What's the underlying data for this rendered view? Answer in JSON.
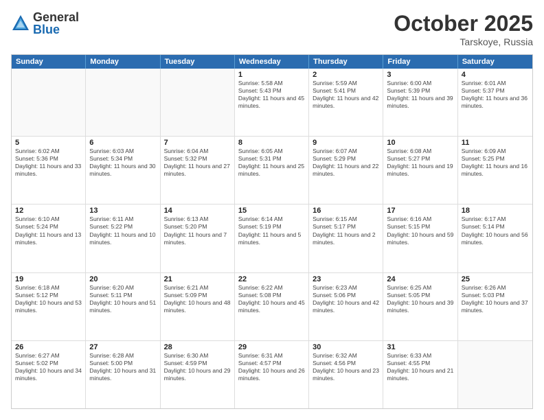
{
  "header": {
    "logo_general": "General",
    "logo_blue": "Blue",
    "month": "October 2025",
    "location": "Tarskoye, Russia"
  },
  "days_of_week": [
    "Sunday",
    "Monday",
    "Tuesday",
    "Wednesday",
    "Thursday",
    "Friday",
    "Saturday"
  ],
  "weeks": [
    [
      {
        "day": "",
        "empty": true
      },
      {
        "day": "",
        "empty": true
      },
      {
        "day": "",
        "empty": true
      },
      {
        "day": "1",
        "sunrise": "5:58 AM",
        "sunset": "5:43 PM",
        "daylight": "11 hours and 45 minutes."
      },
      {
        "day": "2",
        "sunrise": "5:59 AM",
        "sunset": "5:41 PM",
        "daylight": "11 hours and 42 minutes."
      },
      {
        "day": "3",
        "sunrise": "6:00 AM",
        "sunset": "5:39 PM",
        "daylight": "11 hours and 39 minutes."
      },
      {
        "day": "4",
        "sunrise": "6:01 AM",
        "sunset": "5:37 PM",
        "daylight": "11 hours and 36 minutes."
      }
    ],
    [
      {
        "day": "5",
        "sunrise": "6:02 AM",
        "sunset": "5:36 PM",
        "daylight": "11 hours and 33 minutes."
      },
      {
        "day": "6",
        "sunrise": "6:03 AM",
        "sunset": "5:34 PM",
        "daylight": "11 hours and 30 minutes."
      },
      {
        "day": "7",
        "sunrise": "6:04 AM",
        "sunset": "5:32 PM",
        "daylight": "11 hours and 27 minutes."
      },
      {
        "day": "8",
        "sunrise": "6:05 AM",
        "sunset": "5:31 PM",
        "daylight": "11 hours and 25 minutes."
      },
      {
        "day": "9",
        "sunrise": "6:07 AM",
        "sunset": "5:29 PM",
        "daylight": "11 hours and 22 minutes."
      },
      {
        "day": "10",
        "sunrise": "6:08 AM",
        "sunset": "5:27 PM",
        "daylight": "11 hours and 19 minutes."
      },
      {
        "day": "11",
        "sunrise": "6:09 AM",
        "sunset": "5:25 PM",
        "daylight": "11 hours and 16 minutes."
      }
    ],
    [
      {
        "day": "12",
        "sunrise": "6:10 AM",
        "sunset": "5:24 PM",
        "daylight": "11 hours and 13 minutes."
      },
      {
        "day": "13",
        "sunrise": "6:11 AM",
        "sunset": "5:22 PM",
        "daylight": "11 hours and 10 minutes."
      },
      {
        "day": "14",
        "sunrise": "6:13 AM",
        "sunset": "5:20 PM",
        "daylight": "11 hours and 7 minutes."
      },
      {
        "day": "15",
        "sunrise": "6:14 AM",
        "sunset": "5:19 PM",
        "daylight": "11 hours and 5 minutes."
      },
      {
        "day": "16",
        "sunrise": "6:15 AM",
        "sunset": "5:17 PM",
        "daylight": "11 hours and 2 minutes."
      },
      {
        "day": "17",
        "sunrise": "6:16 AM",
        "sunset": "5:15 PM",
        "daylight": "10 hours and 59 minutes."
      },
      {
        "day": "18",
        "sunrise": "6:17 AM",
        "sunset": "5:14 PM",
        "daylight": "10 hours and 56 minutes."
      }
    ],
    [
      {
        "day": "19",
        "sunrise": "6:18 AM",
        "sunset": "5:12 PM",
        "daylight": "10 hours and 53 minutes."
      },
      {
        "day": "20",
        "sunrise": "6:20 AM",
        "sunset": "5:11 PM",
        "daylight": "10 hours and 51 minutes."
      },
      {
        "day": "21",
        "sunrise": "6:21 AM",
        "sunset": "5:09 PM",
        "daylight": "10 hours and 48 minutes."
      },
      {
        "day": "22",
        "sunrise": "6:22 AM",
        "sunset": "5:08 PM",
        "daylight": "10 hours and 45 minutes."
      },
      {
        "day": "23",
        "sunrise": "6:23 AM",
        "sunset": "5:06 PM",
        "daylight": "10 hours and 42 minutes."
      },
      {
        "day": "24",
        "sunrise": "6:25 AM",
        "sunset": "5:05 PM",
        "daylight": "10 hours and 39 minutes."
      },
      {
        "day": "25",
        "sunrise": "6:26 AM",
        "sunset": "5:03 PM",
        "daylight": "10 hours and 37 minutes."
      }
    ],
    [
      {
        "day": "26",
        "sunrise": "6:27 AM",
        "sunset": "5:02 PM",
        "daylight": "10 hours and 34 minutes."
      },
      {
        "day": "27",
        "sunrise": "6:28 AM",
        "sunset": "5:00 PM",
        "daylight": "10 hours and 31 minutes."
      },
      {
        "day": "28",
        "sunrise": "6:30 AM",
        "sunset": "4:59 PM",
        "daylight": "10 hours and 29 minutes."
      },
      {
        "day": "29",
        "sunrise": "6:31 AM",
        "sunset": "4:57 PM",
        "daylight": "10 hours and 26 minutes."
      },
      {
        "day": "30",
        "sunrise": "6:32 AM",
        "sunset": "4:56 PM",
        "daylight": "10 hours and 23 minutes."
      },
      {
        "day": "31",
        "sunrise": "6:33 AM",
        "sunset": "4:55 PM",
        "daylight": "10 hours and 21 minutes."
      },
      {
        "day": "",
        "empty": true
      }
    ]
  ]
}
